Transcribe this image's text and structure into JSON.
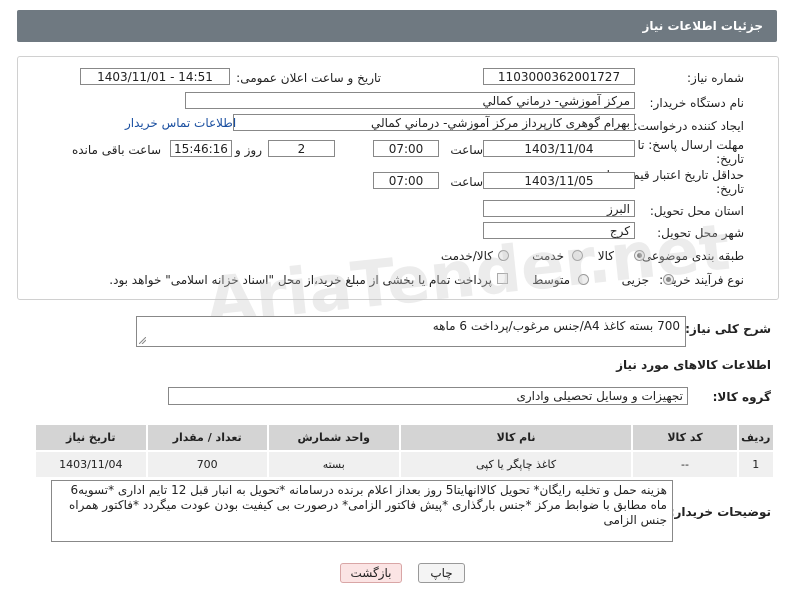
{
  "header": {
    "title": "جزئیات اطلاعات نیاز"
  },
  "form": {
    "need_number": {
      "label": "شماره نیاز:",
      "value": "1103000362001727"
    },
    "announce_datetime": {
      "label": "تاریخ و ساعت اعلان عمومی:",
      "value": "1403/11/01 - 14:51"
    },
    "buyer_org": {
      "label": "نام دستگاه خریدار:",
      "value": "مرکز آموزشي- درماني کمالي"
    },
    "requester": {
      "label": "ایجاد کننده درخواست:",
      "value": "بهرام گوهری کارپرداز مرکز آموزشي- درماني کمالي",
      "contact_link": "اطلاعات تماس خریدار"
    },
    "reply_deadline": {
      "label": "مهلت ارسال پاسخ: تا",
      "label2": "تاریخ:",
      "date": "1403/11/04",
      "time_label": "ساعت",
      "time": "07:00",
      "days": "2",
      "days_label": "روز و",
      "remaining": "15:46:16",
      "remaining_label": "ساعت باقی مانده"
    },
    "price_validity": {
      "label": "حداقل تاریخ اعتبار قیمت: تا",
      "label2": "تاریخ:",
      "date": "1403/11/05",
      "time_label": "ساعت",
      "time": "07:00"
    },
    "province": {
      "label": "استان محل تحویل:",
      "value": "البرز"
    },
    "city": {
      "label": "شهر محل تحویل:",
      "value": "کرج"
    },
    "category": {
      "label": "طبقه بندی موضوعی:",
      "options": [
        "کالا",
        "خدمت",
        "کالا/خدمت"
      ],
      "selected": "کالا"
    },
    "process": {
      "label": "نوع فرآیند خرید :",
      "options": [
        "جزیی",
        "متوسط"
      ],
      "selected": "جزیی",
      "payment_note": "پرداخت تمام یا بخشی از مبلغ خرید،از محل \"اسناد خزانه اسلامی\" خواهد بود."
    }
  },
  "description": {
    "label": "شرح کلی نیاز:",
    "value": "700 بسته کاغذ A4/جنس مرغوب/پرداخت 6 ماهه"
  },
  "goods_info": {
    "title": "اطلاعات کالاهای مورد نیاز",
    "group_label": "گروه کالا:",
    "group_value": "تجهیزات و وسایل تحصیلی واداری",
    "columns": [
      "ردیف",
      "کد کالا",
      "نام کالا",
      "واحد شمارش",
      "تعداد / مقدار",
      "تاریخ نیاز"
    ],
    "rows": [
      [
        "1",
        "--",
        "کاغذ چاپگر یا کپی",
        "بسته",
        "700",
        "1403/11/04"
      ]
    ]
  },
  "buyer_notes": {
    "label": "توضیحات خریدار:",
    "value": "هزینه حمل و تخلیه رایگان* تحویل کالاانهایتا5 روز بعداز اعلام برنده درسامانه *تحویل به انبار قبل 12 تایم اداری *تسویه6 ماه مطابق با ضوابط مرکز *جنس بارگذاری *پیش فاکتور الزامی* درصورت بی کیفیت بودن عودت میگردد *فاکتور همراه جنس الزامی"
  },
  "buttons": {
    "print": "چاپ",
    "back": "بازگشت"
  },
  "watermark": "AriaTender.net"
}
